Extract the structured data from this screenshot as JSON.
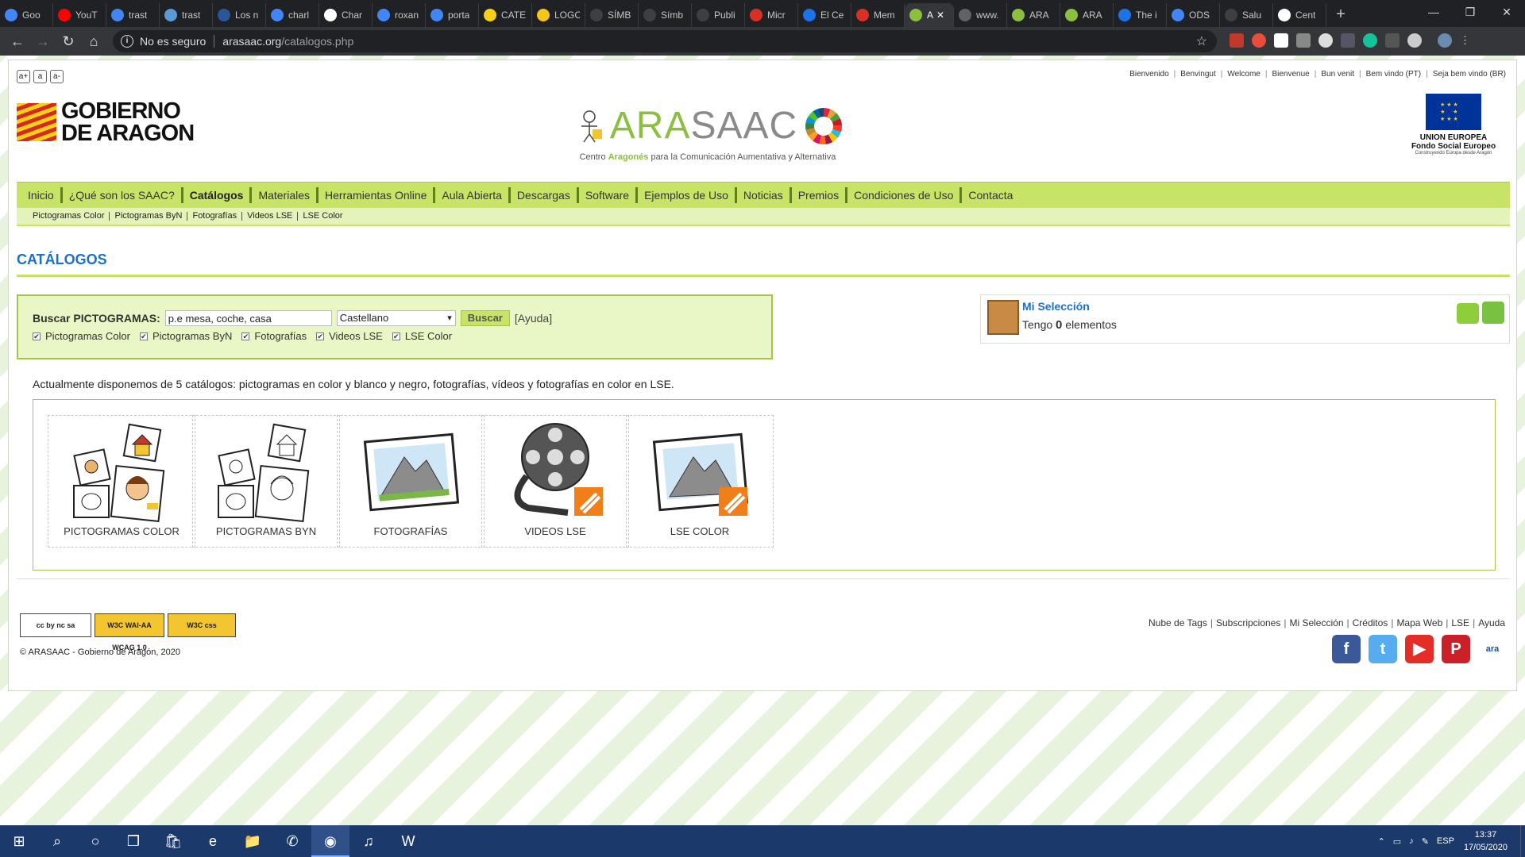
{
  "browser": {
    "tabs": [
      {
        "label": "Goo",
        "color": "#4285f4"
      },
      {
        "label": "YouT",
        "color": "#ff0000"
      },
      {
        "label": "trast",
        "color": "#4285f4"
      },
      {
        "label": "trast",
        "color": "#5b9bd5"
      },
      {
        "label": "Los n",
        "color": "#2b579a"
      },
      {
        "label": "charl",
        "color": "#4285f4"
      },
      {
        "label": "Char",
        "color": "#ffffff"
      },
      {
        "label": "roxan",
        "color": "#4285f4"
      },
      {
        "label": "porta",
        "color": "#4285f4"
      },
      {
        "label": "CATE",
        "color": "#f7d116"
      },
      {
        "label": "LOGC",
        "color": "#f5c518"
      },
      {
        "label": "SÍMB",
        "color": "#3c4043"
      },
      {
        "label": "Símb",
        "color": "#3c4043"
      },
      {
        "label": "Publi",
        "color": "#3c4043"
      },
      {
        "label": "Micr",
        "color": "#d93025"
      },
      {
        "label": "El Ce",
        "color": "#1a73e8"
      },
      {
        "label": "Mem",
        "color": "#d93025"
      }
    ],
    "active_tab": {
      "label": "A",
      "color": "#8cbf3f"
    },
    "tabs_after": [
      {
        "label": "www.",
        "color": "#5f6368"
      },
      {
        "label": "ARA",
        "color": "#8cbf3f"
      },
      {
        "label": "ARA",
        "color": "#8cbf3f"
      },
      {
        "label": "The i",
        "color": "#1a73e8"
      },
      {
        "label": "ODS",
        "color": "#4285f4"
      },
      {
        "label": "Salu",
        "color": "#3c4043"
      },
      {
        "label": "Cent",
        "color": "#ffffff"
      }
    ],
    "security_label": "No es seguro",
    "url_domain": "arasaac.org",
    "url_path": "/catalogos.php"
  },
  "header": {
    "font_size_buttons": [
      "a+",
      "a",
      "a-"
    ],
    "languages": [
      "Bienvenido",
      "Benvingut",
      "Welcome",
      "Bienvenue",
      "Bun venit",
      "Bem vindo (PT)",
      "Seja bem vindo (BR)"
    ],
    "gobierno_line1": "GOBIERNO",
    "gobierno_line2": "DE ARAGON",
    "arasaac_ara": "ARA",
    "arasaac_rest": "SAAC",
    "arasaac_sub_pre": "Centro ",
    "arasaac_sub_bold": "Aragonés",
    "arasaac_sub_post": " para la Comunicación Aumentativa y Alternativa",
    "eu_line1": "UNION EUROPEA",
    "eu_line2": "Fondo  Social  Europeo",
    "eu_line3": "Construyendo Europa desde Aragón"
  },
  "nav": {
    "items": [
      "Inicio",
      "¿Qué son los SAAC?",
      "Catálogos",
      "Materiales",
      "Herramientas Online",
      "Aula Abierta",
      "Descargas",
      "Software",
      "Ejemplos de Uso",
      "Noticias",
      "Premios",
      "Condiciones de Uso",
      "Contacta"
    ],
    "current": "Catálogos",
    "sub": [
      "Pictogramas Color",
      "Pictogramas ByN",
      "Fotografías",
      "Videos LSE",
      "LSE Color"
    ]
  },
  "main": {
    "title": "CATÁLOGOS",
    "search": {
      "label": "Buscar PICTOGRAMAS:",
      "value": "p.e mesa, coche, casa",
      "language": "Castellano",
      "button": "Buscar",
      "help": "[Ayuda]",
      "filters": [
        "Pictogramas Color",
        "Pictogramas ByN",
        "Fotografías",
        "Videos LSE",
        "LSE Color"
      ]
    },
    "selection": {
      "title": "Mi Selección",
      "count_pre": "Tengo ",
      "count": "0",
      "count_post": " elementos"
    },
    "intro": "Actualmente disponemos de 5 catálogos: pictogramas en color y blanco y negro, fotografías, vídeos y fotografías en color en LSE.",
    "catalogs": [
      {
        "label": "PICTOGRAMAS COLOR",
        "icon": "color-pictograms-icon"
      },
      {
        "label": "PICTOGRAMAS BYN",
        "icon": "bw-pictograms-icon"
      },
      {
        "label": "FOTOGRAFÍAS",
        "icon": "photo-icon"
      },
      {
        "label": "VIDEOS LSE",
        "icon": "film-reel-icon"
      },
      {
        "label": "LSE COLOR",
        "icon": "lse-photo-icon"
      }
    ]
  },
  "footer": {
    "badges": [
      "cc by nc sa",
      "W3C WAI-AA WCAG 1.0",
      "W3C css"
    ],
    "copyright": "© ARASAAC - Gobierno de Aragón, 2020",
    "links": [
      "Nube de Tags",
      "Subscripciones",
      "Mi Selección",
      "Créditos",
      "Mapa Web",
      "LSE",
      "Ayuda"
    ],
    "social": [
      {
        "name": "facebook",
        "glyph": "f",
        "color": "#3b5998"
      },
      {
        "name": "twitter",
        "glyph": "t",
        "color": "#55acee"
      },
      {
        "name": "youtube",
        "glyph": "▶",
        "color": "#e52d27"
      },
      {
        "name": "pinterest",
        "glyph": "P",
        "color": "#cb2027"
      },
      {
        "name": "aratools",
        "glyph": "ara",
        "color": "#ffffff"
      }
    ]
  },
  "taskbar": {
    "lang": "ESP",
    "time": "13:37",
    "date": "17/05/2020"
  }
}
